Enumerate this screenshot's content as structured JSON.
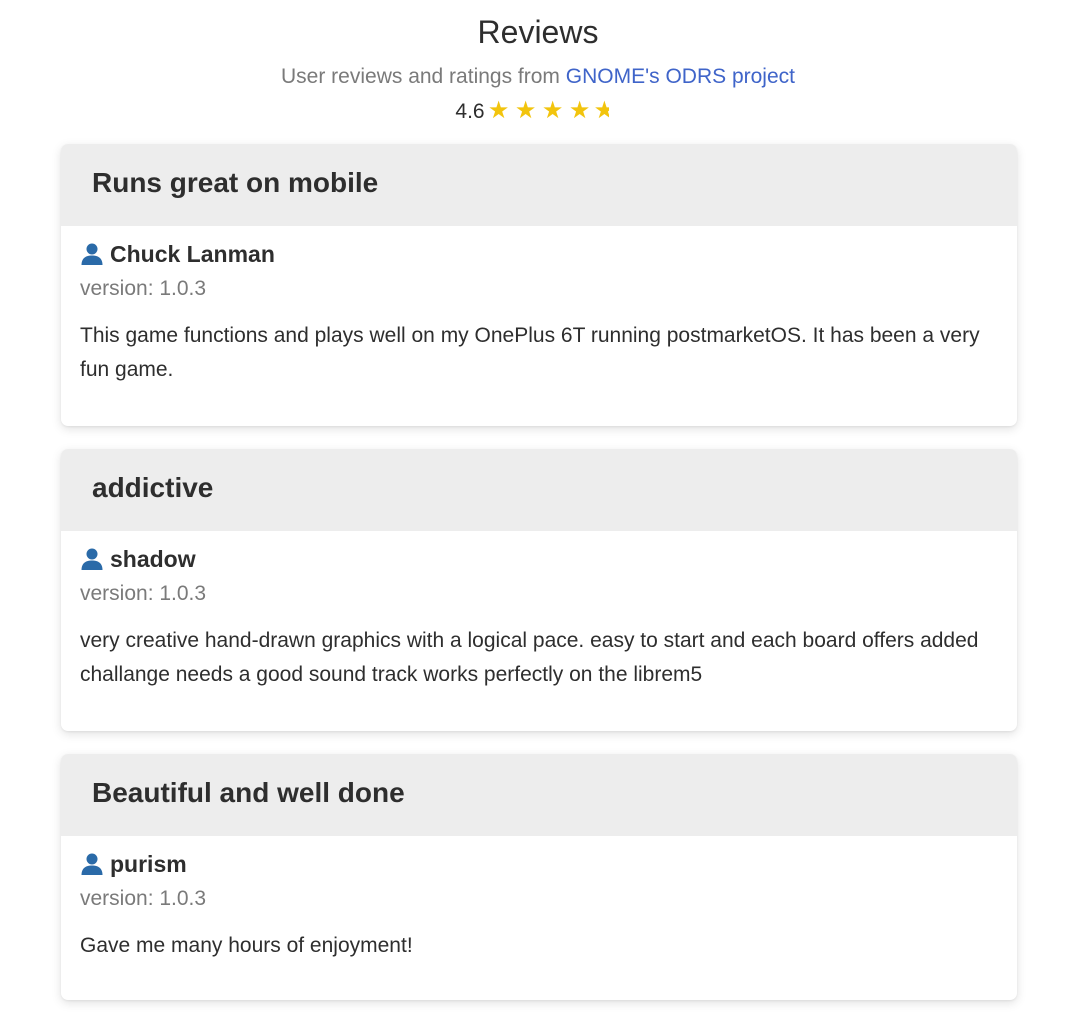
{
  "header": {
    "title": "Reviews",
    "subtitle_prefix": "User reviews and ratings from ",
    "subtitle_link": "GNOME's ODRS project",
    "rating_value": "4.6",
    "rating_stars": 4.6,
    "star_color": "#f2c40d",
    "link_color": "#3f64c9"
  },
  "reviews": [
    {
      "title": "Runs great on mobile",
      "author": "Chuck Lanman",
      "version": "version: 1.0.3",
      "text": "This game functions and plays well on my OnePlus 6T running postmarketOS. It has been a very fun game."
    },
    {
      "title": "addictive",
      "author": "shadow",
      "version": "version: 1.0.3",
      "text": "very creative hand-drawn graphics with a logical pace. easy to start and each board offers added challange needs a good sound track works perfectly on the librem5"
    },
    {
      "title": "Beautiful and well done",
      "author": "purism",
      "version": "version: 1.0.3",
      "text": "Gave me many hours of enjoyment!"
    }
  ],
  "icons": {
    "user": "user-icon",
    "star": "star-icon"
  },
  "colors": {
    "card_header_bg": "#ededed",
    "user_icon": "#2a6aa8",
    "muted_text": "#7a7a7a"
  }
}
